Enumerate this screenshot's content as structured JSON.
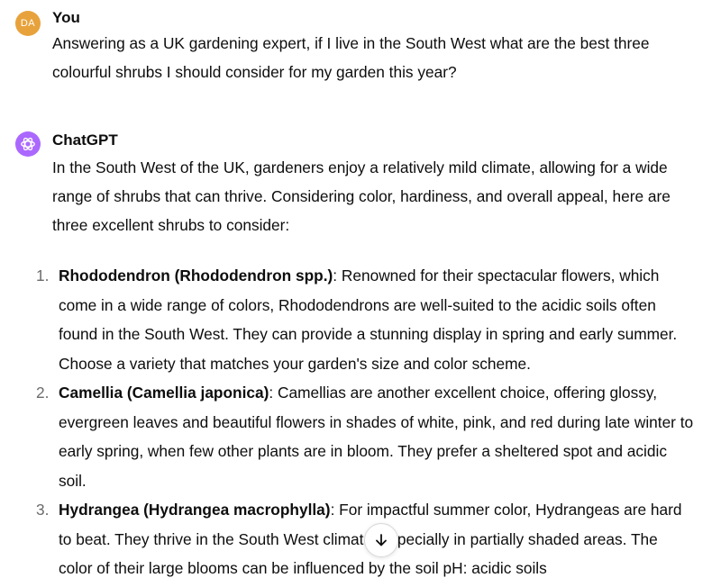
{
  "conversation": {
    "user_message": {
      "avatar_initials": "DA",
      "author": "You",
      "text": "Answering as a UK gardening expert, if I live in the South West what are the best three colourful shrubs I should consider for my garden this year?"
    },
    "assistant_message": {
      "author": "ChatGPT",
      "avatar_icon": "openai-logo-icon",
      "intro": "In the South West of the UK, gardeners enjoy a relatively mild climate, allowing for a wide range of shrubs that can thrive. Considering color, hardiness, and overall appeal, here are three excellent shrubs to consider:",
      "items": [
        {
          "number": "1.",
          "title": "Rhododendron (Rhododendron spp.)",
          "text": ": Renowned for their spectacular flowers, which come in a wide range of colors, Rhododendrons are well-suited to the acidic soils often found in the South West. They can provide a stunning display in spring and early summer. Choose a variety that matches your garden's size and color scheme."
        },
        {
          "number": "2.",
          "title": "Camellia (Camellia japonica)",
          "text": ": Camellias are another excellent choice, offering glossy, evergreen leaves and beautiful flowers in shades of white, pink, and red during late winter to early spring, when few other plants are in bloom. They prefer a sheltered spot and acidic soil."
        },
        {
          "number": "3.",
          "title": "Hydrangea (Hydrangea macrophylla)",
          "text": ": For impactful summer color, Hydrangeas are hard to beat. They thrive in the South West climate, especially in partially shaded areas. The color of their large blooms can be influenced by the soil pH: acidic soils"
        }
      ]
    }
  },
  "scroll_button": {
    "icon": "arrow-down-icon"
  },
  "colors": {
    "user_avatar": "#e8a23c",
    "assistant_avatar": "#ab68ff",
    "text": "#0d0d0d",
    "list_number": "#6b6b6b"
  }
}
